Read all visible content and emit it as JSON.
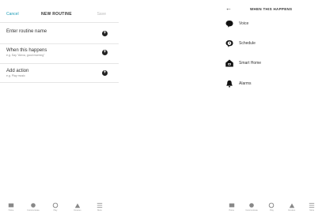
{
  "left": {
    "header": {
      "cancel": "Cancel",
      "title": "NEW ROUTINE",
      "save": "Save"
    },
    "rows": [
      {
        "label": "Enter routine name",
        "sub": ""
      },
      {
        "label": "When this happens",
        "sub": "e.g. Say \"Alexa, good morning\""
      },
      {
        "label": "Add action",
        "sub": "e.g. Play music"
      }
    ]
  },
  "right": {
    "header": {
      "title": "WHEN THIS HAPPENS"
    },
    "options": [
      {
        "label": "Voice",
        "icon": "voice-bubble-icon"
      },
      {
        "label": "Schedule",
        "icon": "schedule-clock-icon"
      },
      {
        "label": "Smart Home",
        "icon": "smart-home-icon"
      },
      {
        "label": "Alarms",
        "icon": "bell-icon"
      }
    ]
  },
  "nav": {
    "items": [
      {
        "label": "Home",
        "icon": "home-icon"
      },
      {
        "label": "Communicate",
        "icon": "chat-icon"
      },
      {
        "label": "Play",
        "icon": "play-icon"
      },
      {
        "label": "Devices",
        "icon": "devices-icon"
      },
      {
        "label": "More",
        "icon": "menu-icon"
      }
    ]
  }
}
